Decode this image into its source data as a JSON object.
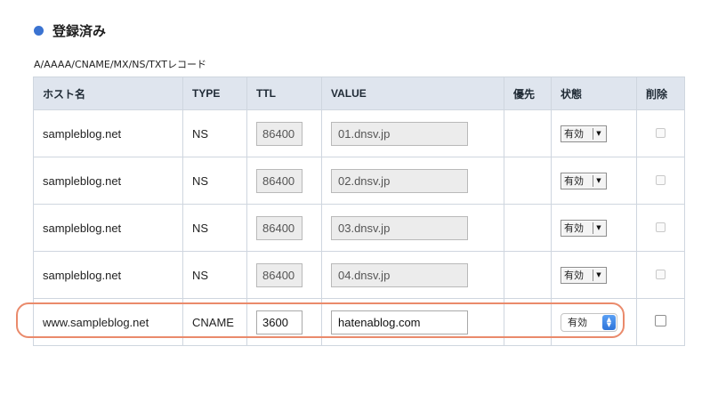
{
  "section": {
    "title": "登録済み",
    "accent_color": "#3b73d1"
  },
  "record_types_label": "A/AAAA/CNAME/MX/NS/TXTレコード",
  "table": {
    "headers": {
      "host": "ホスト名",
      "type": "TYPE",
      "ttl": "TTL",
      "value": "VALUE",
      "priority": "優先",
      "status": "状態",
      "delete": "削除"
    },
    "rows": [
      {
        "host": "sampleblog.net",
        "type": "NS",
        "ttl": "86400",
        "value": "01.dnsv.jp",
        "priority": "",
        "status": "有効",
        "editable": false
      },
      {
        "host": "sampleblog.net",
        "type": "NS",
        "ttl": "86400",
        "value": "02.dnsv.jp",
        "priority": "",
        "status": "有効",
        "editable": false
      },
      {
        "host": "sampleblog.net",
        "type": "NS",
        "ttl": "86400",
        "value": "03.dnsv.jp",
        "priority": "",
        "status": "有効",
        "editable": false
      },
      {
        "host": "sampleblog.net",
        "type": "NS",
        "ttl": "86400",
        "value": "04.dnsv.jp",
        "priority": "",
        "status": "有効",
        "editable": false
      },
      {
        "host": "www.sampleblog.net",
        "type": "CNAME",
        "ttl": "3600",
        "value": "hatenablog.com",
        "priority": "",
        "status": "有効",
        "editable": true
      }
    ]
  },
  "colors": {
    "header_bg": "#dfe5ee",
    "highlight": "#ea8a6b",
    "select_accent": "#2e74d9"
  }
}
